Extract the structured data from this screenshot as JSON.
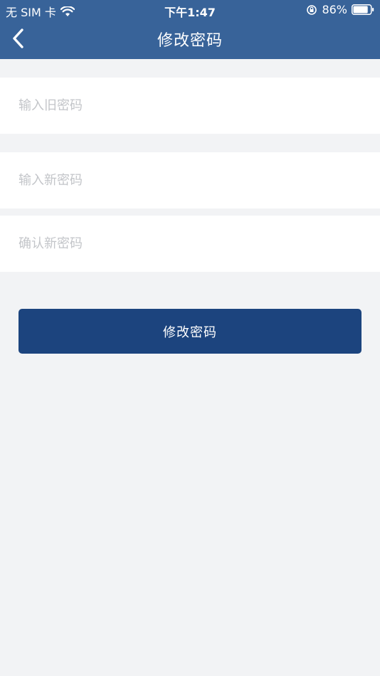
{
  "status_bar": {
    "carrier": "无 SIM 卡",
    "time": "下午1:47",
    "battery_percent": "86%",
    "battery_level": 0.86
  },
  "nav": {
    "title": "修改密码",
    "back_icon": "chevron-left-icon"
  },
  "form": {
    "old_password_placeholder": "输入旧密码",
    "new_password_placeholder": "输入新密码",
    "confirm_password_placeholder": "确认新密码",
    "submit_label": "修改密码"
  },
  "colors": {
    "header_bg": "#386399",
    "button_bg": "#1c447e",
    "page_bg": "#f2f3f5",
    "placeholder": "#c3c5c9"
  }
}
